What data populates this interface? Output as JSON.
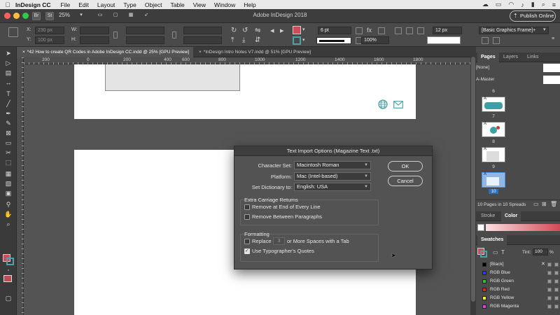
{
  "menubar": {
    "app": "InDesign CC",
    "items": [
      "File",
      "Edit",
      "Layout",
      "Type",
      "Object",
      "Table",
      "View",
      "Window",
      "Help"
    ]
  },
  "appbar": {
    "title": "Adobe InDesign 2018",
    "bridge": "Br",
    "stock": "St",
    "zoom": "25%",
    "publish": "Publish Online"
  },
  "control": {
    "x_label": "X:",
    "y_label": "Y:",
    "w_label": "W:",
    "h_label": "H:",
    "x_value": "230 px",
    "y_value": "100 px",
    "stroke_weight": "6 pt",
    "opacity": "100%",
    "corner": "12 px",
    "object_style": "[Basic Graphics Frame]+"
  },
  "tabs": [
    {
      "label": "*42 How to create QR Codes in Adobe InDesign CC.indd @ 25% [GPU Preview]"
    },
    {
      "label": "*InDesign Intro Notes V7.indd @ 51% [GPU Preview]"
    }
  ],
  "ruler": {
    "ticks": [
      "200",
      "0",
      "200",
      "400",
      "600",
      "800",
      "1000",
      "1200",
      "1400",
      "1600",
      "1800"
    ]
  },
  "pages_panel": {
    "tabs": [
      "Pages",
      "Layers",
      "Links"
    ],
    "none_label": "[None]",
    "master_label": "A-Master",
    "page_numbers": [
      "6",
      "7",
      "8",
      "9",
      "10"
    ],
    "thumb_letter": "A",
    "footer": "10 Pages in 10 Spreads"
  },
  "stroke_color_tabs": [
    "Stroke",
    "Color"
  ],
  "swatches": {
    "title": "Swatches",
    "tint_label": "Tint:",
    "tint_value": "100",
    "percent": "%",
    "items": [
      {
        "name": "[Black]",
        "color": "#000000"
      },
      {
        "name": "RGB Blue",
        "color": "#1d3ff0"
      },
      {
        "name": "RGB Green",
        "color": "#2fc52f"
      },
      {
        "name": "RGB Red",
        "color": "#f01c1c"
      },
      {
        "name": "RGB Yellow",
        "color": "#f7ee2b"
      },
      {
        "name": "RGB Magenta",
        "color": "#e93fe9"
      }
    ]
  },
  "dialog": {
    "title": "Text Import Options (Magazine Text .txt)",
    "character_set_label": "Character Set:",
    "character_set_value": "Macintosh Roman",
    "platform_label": "Platform:",
    "platform_value": "Mac (Intel-based)",
    "dictionary_label": "Set Dictionary to:",
    "dictionary_value": "English: USA",
    "ok": "OK",
    "cancel": "Cancel",
    "extra_returns_heading": "Extra Carriage Returns",
    "remove_end_of_line": "Remove at End of Every Line",
    "remove_between_paragraphs": "Remove Between Paragraphs",
    "formatting_heading": "Formatting",
    "replace_label": "Replace",
    "replace_count": "3",
    "replace_suffix": "or More Spaces with a Tab",
    "typographers_quotes": "Use Typographer's Quotes",
    "checks": {
      "remove_end_of_line": false,
      "remove_between_paragraphs": false,
      "replace_spaces": false,
      "typographers_quotes": true
    }
  },
  "colors": {
    "accent_teal": "#4aa3a8",
    "swatch_red": "#d24a57"
  }
}
